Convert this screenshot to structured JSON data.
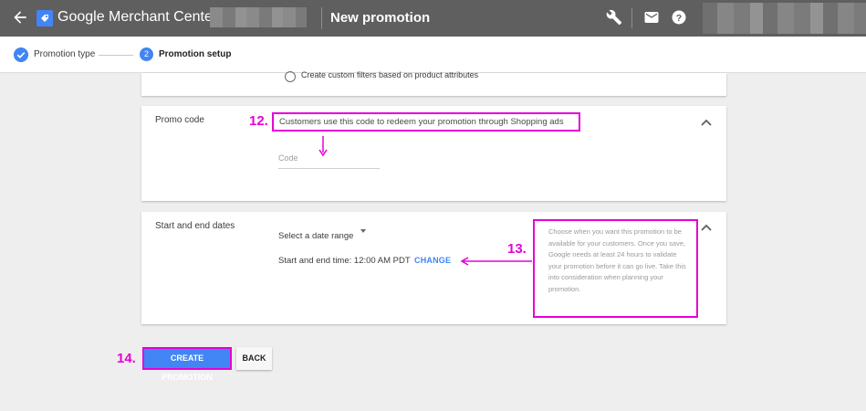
{
  "appbar": {
    "title": "Google Merchant Center",
    "page_title": "New promotion",
    "icons": [
      "back-arrow-icon",
      "merchant-center-logo-icon",
      "wrench-icon",
      "mail-icon",
      "help-icon"
    ]
  },
  "stepper": {
    "steps": [
      {
        "label": "Promotion type",
        "state": "complete"
      },
      {
        "number": "2",
        "label": "Promotion setup",
        "state": "active"
      }
    ]
  },
  "filters": {
    "option_label": "Create custom filters based on product attributes"
  },
  "promo_code": {
    "label": "Promo code",
    "hint": "Customers use this code to redeem your promotion through Shopping ads",
    "placeholder": "Code"
  },
  "dates": {
    "label": "Start and end dates",
    "select_value": "Select a date range",
    "time_text": "Start and end time: 12:00 AM PDT",
    "change_label": "CHANGE",
    "help": "Choose when you want this promotion to be available for your customers. Once you save, Google needs at least 24 hours to validate your promotion before it can go live. Take this into consideration when planning your promotion."
  },
  "annotations": {
    "m12": "12.",
    "m13": "13.",
    "m14": "14."
  },
  "actions": {
    "create_label": "CREATE PROMOTION",
    "back_label": "BACK"
  },
  "colors": {
    "appbar": "#5f5f5f",
    "accent": "#4285f4",
    "annotation": "#e600d6"
  }
}
